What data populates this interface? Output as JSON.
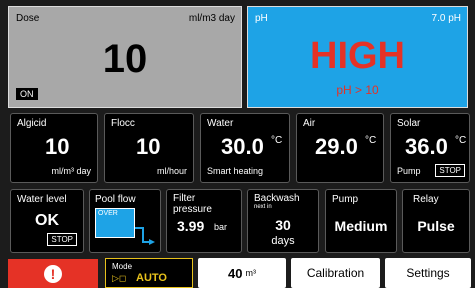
{
  "dose": {
    "label": "Dose",
    "unit": "ml/m3 day",
    "value": "10",
    "status": "ON"
  },
  "ph": {
    "label": "pH",
    "setpoint": "7.0 pH",
    "state": "HIGH",
    "reading": "pH > 10"
  },
  "algicid": {
    "label": "Algicid",
    "value": "10",
    "unit": "ml/m³ day"
  },
  "flocc": {
    "label": "Flocc",
    "value": "10",
    "unit": "ml/hour"
  },
  "water": {
    "label": "Water",
    "value": "30.0",
    "deg": "°C",
    "sub": "Smart heating"
  },
  "air": {
    "label": "Air",
    "value": "29.0",
    "deg": "°C"
  },
  "solar": {
    "label": "Solar",
    "value": "36.0",
    "deg": "°C",
    "sub": "Pump",
    "stop": "STOP"
  },
  "water_level": {
    "label": "Water level",
    "value": "OK",
    "stop": "STOP"
  },
  "pool_flow": {
    "label": "Pool flow",
    "box_text": "OVER"
  },
  "filter": {
    "label": "Filter pressure",
    "value": "3.99",
    "unit": "bar"
  },
  "backwash": {
    "label": "Backwash",
    "sub": "next in",
    "value": "30",
    "unit": "days"
  },
  "pump": {
    "label": "Pump",
    "value": "Medium"
  },
  "relay": {
    "label": "Relay",
    "value": "Pulse"
  },
  "bottom": {
    "alert": "!",
    "mode_label": "Mode",
    "mode_value": "AUTO",
    "volume_value": "40",
    "volume_unit": "m³",
    "calibration": "Calibration",
    "settings": "Settings"
  },
  "colors": {
    "dose_bg": "#a8a8a8",
    "ph_bg": "#1ea3e6",
    "alert_red": "#e53226",
    "mode_yellow": "#e8c21c"
  }
}
